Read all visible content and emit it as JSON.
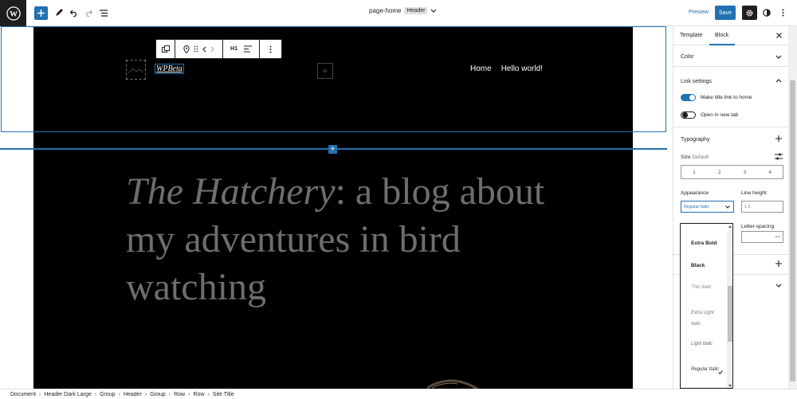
{
  "topbar": {
    "doc_title": "page-home",
    "doc_badge": "Header",
    "preview_label": "Preview",
    "save_label": "Save"
  },
  "canvas": {
    "site_title": "WPBeta",
    "toolbar_heading_level": "H1",
    "nav": [
      "Home",
      "Hello world!"
    ],
    "hero_italic": "The Hatchery",
    "hero_rest": ": a blog about my adventures in bird watching"
  },
  "sidebar": {
    "tabs": [
      "Template",
      "Block"
    ],
    "color_label": "Color",
    "link_settings_label": "Link settings",
    "make_title_link": "Make title link to home",
    "open_new_tab": "Open in new tab",
    "typography_label": "Typography",
    "size_label": "Size",
    "size_value": "Default",
    "size_options": [
      "1",
      "2",
      "3",
      "4"
    ],
    "appearance_label": "Appearance",
    "appearance_value": "Regular Italic",
    "line_height_label": "Line height",
    "line_height_value": "1.5",
    "letter_spacing_label": "Letter-spacing",
    "letter_spacing_unit": "PX"
  },
  "dropdown": {
    "items": [
      "Extra Bold",
      "Black",
      "Thin Italic",
      "Extra Light Italic",
      "Light Italic",
      "Regular Italic"
    ],
    "selected": "Regular Italic"
  },
  "breadcrumbs": [
    "Document",
    "Header Dark Large",
    "Group",
    "Header",
    "Group",
    "Row",
    "Row",
    "Site Title"
  ],
  "colors": {
    "accent": "#2271b1",
    "dark": "#1e1e1e",
    "canvas_bg": "#000000",
    "hero_text": "#6e6e6e"
  }
}
